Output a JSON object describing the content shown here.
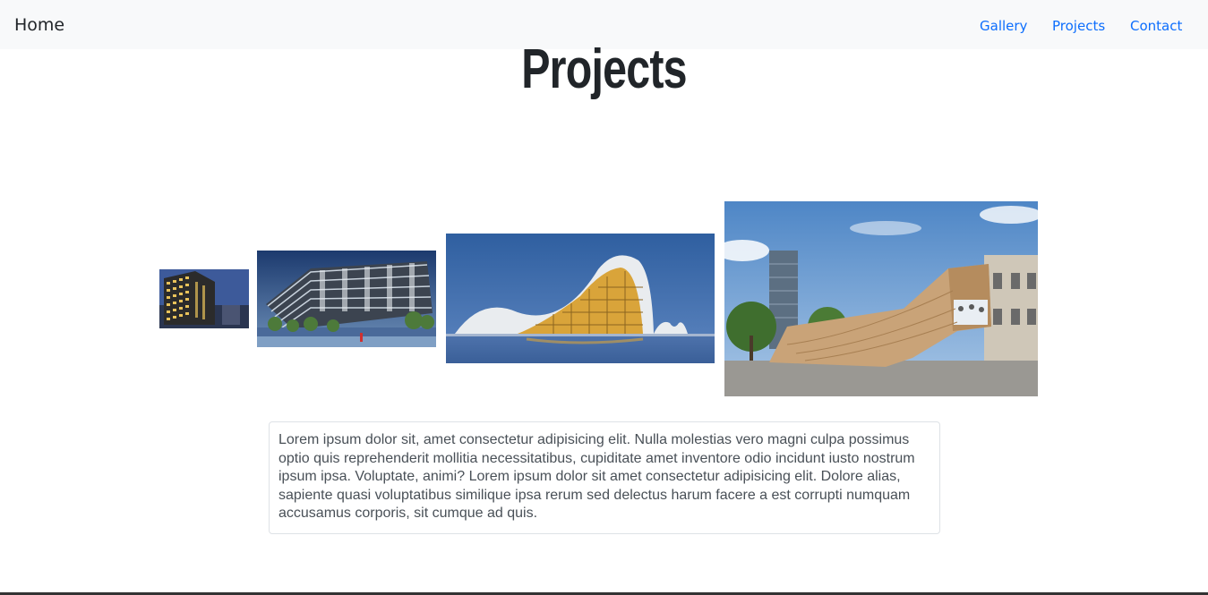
{
  "navbar": {
    "brand": "Home",
    "links": [
      {
        "label": "Gallery"
      },
      {
        "label": "Projects"
      },
      {
        "label": "Contact"
      }
    ],
    "background": "#f8f9fa",
    "link_color": "#0d6efd"
  },
  "page": {
    "title": "Projects"
  },
  "gallery": {
    "images": [
      {
        "subject": "glass office tower at dusk"
      },
      {
        "subject": "modern glass office building at night"
      },
      {
        "subject": "curved white cultural center at twilight"
      },
      {
        "subject": "wooden cantilevered pavilion in plaza"
      }
    ]
  },
  "description": {
    "text": "Lorem ipsum dolor sit, amet consectetur adipisicing elit. Nulla molestias vero magni culpa possimus optio quis reprehenderit mollitia necessitatibus, cupiditate amet inventore odio incidunt iusto nostrum ipsum ipsa. Voluptate, animi? Lorem ipsum dolor sit amet consectetur adipisicing elit. Dolore alias, sapiente quasi voluptatibus similique ipsa rerum sed delectus harum facere a est corrupti numquam accusamus corporis, sit cumque ad quis."
  }
}
